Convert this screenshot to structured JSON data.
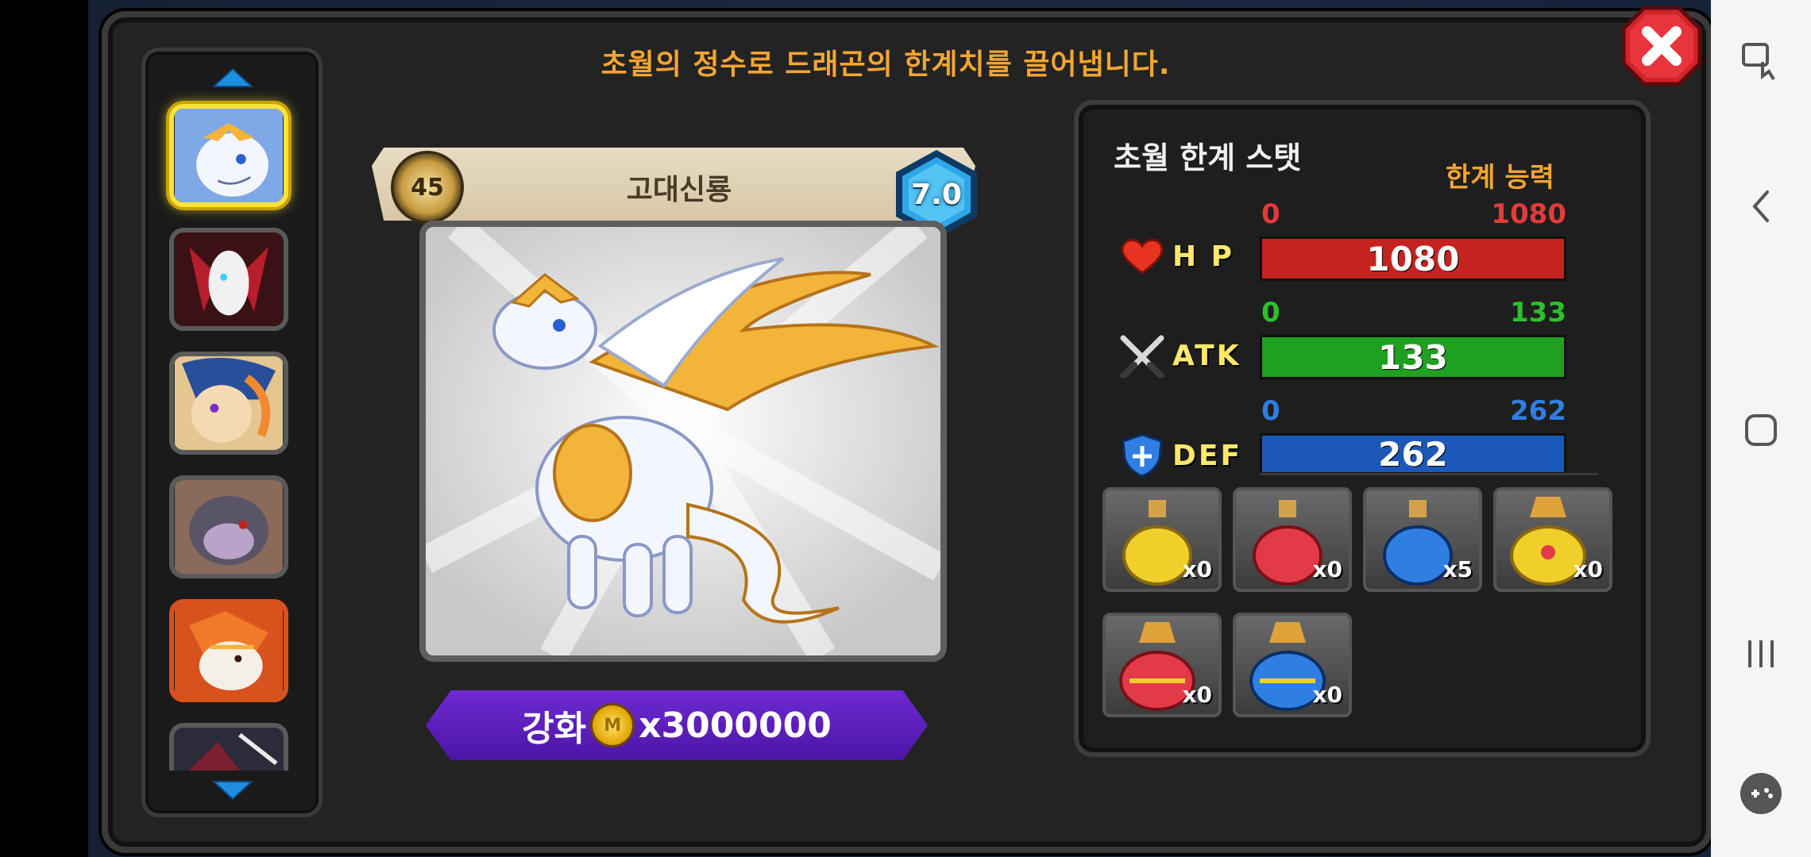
{
  "headline": "초월의 정수로 드래곤의 한계치를 끌어냅니다.",
  "hero": {
    "level": "45",
    "name": "고대신룡",
    "grade": "7.0"
  },
  "upgrade": {
    "label": "강화",
    "coin_symbol": "M",
    "cost": "x3000000"
  },
  "stats": {
    "title": "초월 한계 스탯",
    "subtitle": "한계 능력",
    "rows": [
      {
        "label": "H P",
        "icon": "heart-icon",
        "min": "0",
        "max": "1080",
        "value": "1080",
        "fill": 1.0,
        "color": "#c4231f",
        "minmax_color": "#e23b3b"
      },
      {
        "label": "ATK",
        "icon": "crossed-swords-icon",
        "min": "0",
        "max": "133",
        "value": "133",
        "fill": 1.0,
        "color": "#1fa020",
        "minmax_color": "#2cc02c"
      },
      {
        "label": "DEF",
        "icon": "shield-icon",
        "min": "0",
        "max": "262",
        "value": "262",
        "fill": 1.0,
        "color": "#1c58b8",
        "minmax_color": "#2f7fe3"
      }
    ]
  },
  "items": [
    {
      "name": "yellow-potion",
      "count": "x0",
      "color": "#f0cf2a"
    },
    {
      "name": "red-potion",
      "count": "x0",
      "color": "#e23a48"
    },
    {
      "name": "blue-potion",
      "count": "x5",
      "color": "#2f7fe3"
    },
    {
      "name": "gold-ornate-potion",
      "count": "x0",
      "color": "#f0cf2a"
    },
    {
      "name": "red-ornate-potion",
      "count": "x0",
      "color": "#e23a48"
    },
    {
      "name": "blue-ornate-potion",
      "count": "x0",
      "color": "#2f7fe3"
    }
  ],
  "dragon_list": [
    {
      "name": "ancient-god-dragon",
      "selected": true
    },
    {
      "name": "red-white-dragon",
      "selected": false
    },
    {
      "name": "blue-fire-dragon",
      "selected": false
    },
    {
      "name": "grey-rock-dragon",
      "selected": false
    },
    {
      "name": "orange-flame-dragon",
      "selected": false
    },
    {
      "name": "dark-dragon",
      "selected": false
    }
  ]
}
